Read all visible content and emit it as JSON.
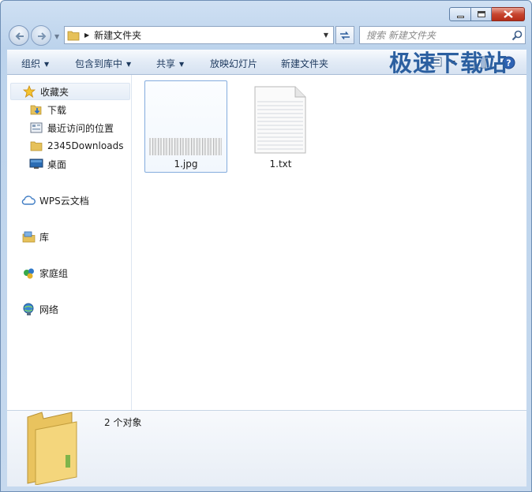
{
  "window": {
    "address_path": "新建文件夹",
    "search_placeholder": "搜索 新建文件夹"
  },
  "toolbar": {
    "organize": "组织",
    "include_in_library": "包含到库中",
    "share": "共享",
    "slideshow": "放映幻灯片",
    "new_folder": "新建文件夹"
  },
  "nav": {
    "favorites": "收藏夹",
    "favorites_items": [
      "下载",
      "最近访问的位置",
      "2345Downloads",
      "桌面"
    ],
    "wps_cloud": "WPS云文档",
    "libraries": "库",
    "homegroup": "家庭组",
    "network": "网络"
  },
  "files": [
    {
      "name": "1.jpg",
      "type": "image"
    },
    {
      "name": "1.txt",
      "type": "text"
    }
  ],
  "status": {
    "item_count": "2 个对象"
  },
  "watermark": "极速下载站",
  "icons": [
    "back-icon",
    "forward-icon",
    "folder-icon",
    "refresh-icon",
    "search-icon",
    "view-icon",
    "preview-pane-icon",
    "help-icon",
    "star-icon",
    "download-folder-icon",
    "recent-places-icon",
    "desktop-icon",
    "cloud-icon",
    "library-icon",
    "homegroup-icon",
    "network-icon"
  ]
}
